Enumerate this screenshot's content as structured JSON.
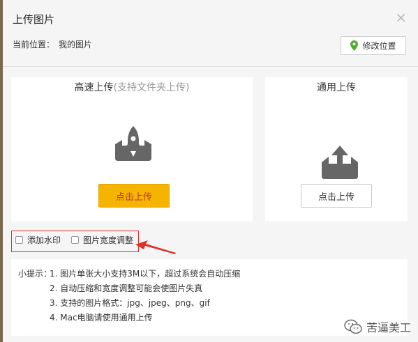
{
  "dialog": {
    "title": "上传图片",
    "close_glyph": "×",
    "location_label": "当前位置：",
    "location_value": "我的图片",
    "modify_location_label": "修改位置"
  },
  "fast_upload": {
    "title": "高速上传",
    "subtitle": "(支持文件夹上传)",
    "button_label": "点击上传"
  },
  "normal_upload": {
    "title": "通用上传",
    "button_label": "点击上传"
  },
  "options": {
    "watermark_label": "添加水印",
    "width_adjust_label": "图片宽度调整"
  },
  "tips": {
    "label": "小提示：",
    "items": [
      "1. 图片单张大小支持3M以下，超过系统会自动压缩",
      "2. 自动压缩和宽度调整可能会使图片失真",
      "3. 支持的图片格式：jpg、jpeg、png、gif",
      "4. Mac电脑请使用通用上传"
    ]
  },
  "watermark_text": "苦逼美工",
  "colors": {
    "primary_button": "#f5b400",
    "primary_button_text": "#c0392b",
    "highlight_box": "#e0302c",
    "location_pin": "#4cae2a",
    "icon_gray": "#666666"
  },
  "icons": {
    "close": "close-icon",
    "location": "location-pin-icon",
    "fast_upload": "rocket-icon",
    "normal_upload": "upload-tray-icon",
    "arrow": "red-arrow-icon",
    "watermark": "wechat-icon"
  }
}
